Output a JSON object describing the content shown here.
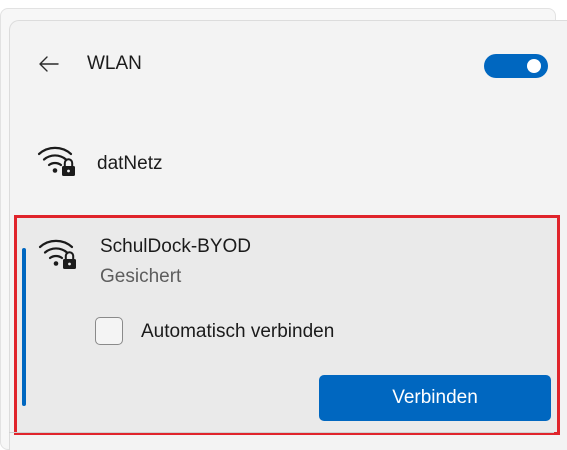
{
  "header": {
    "title": "WLAN",
    "back_icon": "arrow-left-icon",
    "toggle_state": "on",
    "accent_color": "#0067c0"
  },
  "networks": [
    {
      "name": "datNetz",
      "icon": "wifi-secured-icon"
    },
    {
      "name": "SchulDock-BYOD",
      "icon": "wifi-secured-icon",
      "status": "Gesichert",
      "auto_connect_label": "Automatisch verbinden",
      "auto_connect_checked": false,
      "connect_label": "Verbinden",
      "selected": true
    }
  ],
  "highlight_color": "#e0242b"
}
